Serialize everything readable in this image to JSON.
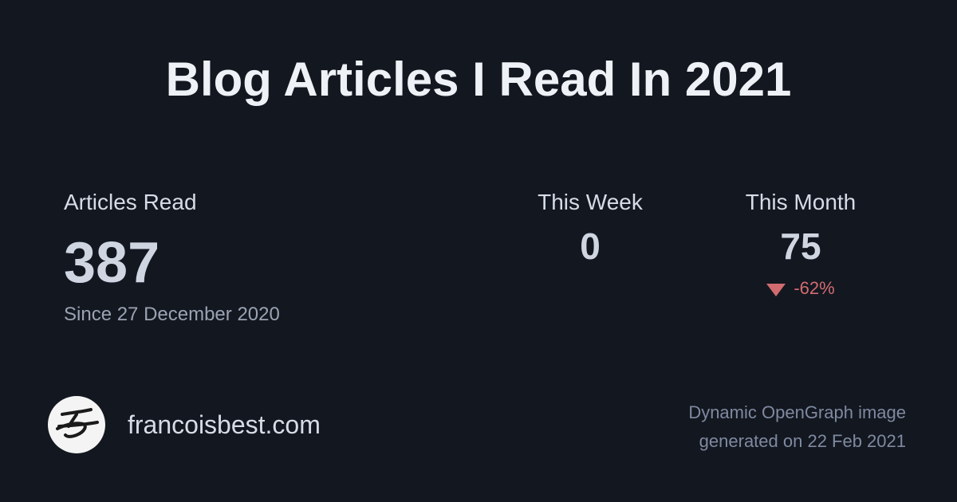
{
  "title": "Blog Articles I Read In 2021",
  "articles": {
    "label": "Articles Read",
    "value": "387",
    "since": "Since 27 December 2020"
  },
  "week": {
    "label": "This Week",
    "value": "0"
  },
  "month": {
    "label": "This Month",
    "value": "75",
    "change": "-62%",
    "change_icon": "triangle-down-icon",
    "change_color": "#d26b6f"
  },
  "footer": {
    "site": "francoisbest.com",
    "logo_icon": "francois-best-logo-icon",
    "note_line1": "Dynamic OpenGraph image",
    "note_line2": "generated on 22 Feb 2021"
  },
  "colors": {
    "background": "#131720",
    "title": "#eef1f6",
    "muted": "#7f8aa0",
    "negative": "#d26b6f"
  }
}
